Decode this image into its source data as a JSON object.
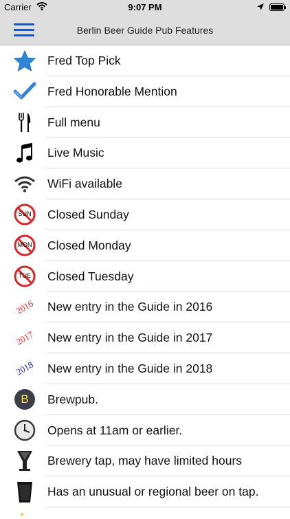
{
  "status_bar": {
    "carrier": "Carrier",
    "time": "9:07 PM"
  },
  "nav": {
    "title": "Berlin Beer Guide Pub Features",
    "menu_icon": "hamburger-menu-icon",
    "accent_color": "#2257a6"
  },
  "features": [
    {
      "icon": "star-icon",
      "label": "Fred Top Pick"
    },
    {
      "icon": "checkmark-icon",
      "label": "Fred Honorable Mention"
    },
    {
      "icon": "fork-knife-icon",
      "label": "Full menu"
    },
    {
      "icon": "music-note-icon",
      "label": "Live Music"
    },
    {
      "icon": "wifi-icon",
      "label": "WiFi available"
    },
    {
      "icon": "no-sunday-icon",
      "badge": "SUN",
      "label": "Closed Sunday"
    },
    {
      "icon": "no-monday-icon",
      "badge": "MON",
      "label": "Closed Monday"
    },
    {
      "icon": "no-tuesday-icon",
      "badge": "TUE",
      "label": "Closed Tuesday"
    },
    {
      "icon": "year-2016-icon",
      "badge": "2016",
      "badge_color": "#e0262b",
      "label": "New entry in the Guide in 2016"
    },
    {
      "icon": "year-2017-icon",
      "badge": "2017",
      "badge_color": "#e0262b",
      "label": "New entry in the Guide in 2017"
    },
    {
      "icon": "year-2018-icon",
      "badge": "2018",
      "badge_color": "#1c25b5",
      "label": "New entry in the Guide in 2018"
    },
    {
      "icon": "brewpub-icon",
      "badge": "B",
      "label": "Brewpub."
    },
    {
      "icon": "clock-icon",
      "label": "Opens at 11am or earlier."
    },
    {
      "icon": "wine-glass-icon",
      "label": "Brewery tap, may have limited hours"
    },
    {
      "icon": "beer-glass-icon",
      "label": "Has an unusual or regional beer on tap."
    }
  ]
}
